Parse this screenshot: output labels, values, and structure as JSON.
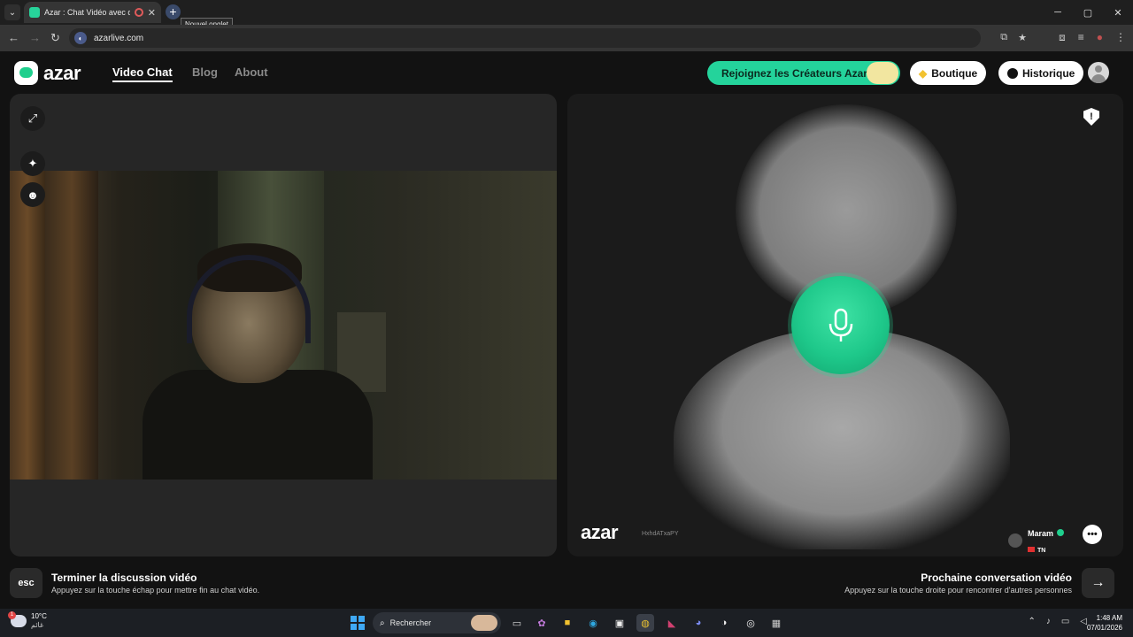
{
  "browser": {
    "tab_title": "Azar : Chat Vidéo avec de n",
    "tab_close": "✕",
    "new_tab": "+",
    "tooltip": "Nouvel onglet",
    "url": "azarlive.com",
    "window_controls": [
      "─",
      "▢",
      "✕"
    ]
  },
  "site": {
    "logo_text": "azar",
    "nav": [
      "Video Chat",
      "Blog",
      "About"
    ],
    "creators_label": "Rejoignez les Créateurs Azar",
    "shop_label": "Boutique",
    "history_label": "Historique"
  },
  "remote": {
    "logo_text": "azar",
    "id": "HxhdATxaPY",
    "peer_name": "Maram",
    "peer_country": "TN",
    "chat_icon": "•••"
  },
  "instructions": {
    "esc_key": "esc",
    "end_title": "Terminer la discussion vidéo",
    "end_desc": "Appuyez sur la touche échap pour mettre fin au chat vidéo.",
    "next_title": "Prochaine conversation vidéo",
    "next_desc": "Appuyez sur la touche droite pour rencontrer d'autres personnes",
    "next_arrow": "→"
  },
  "taskbar": {
    "weather_temp": "10°C",
    "weather_cond": "غائم",
    "weather_badge": "1",
    "search_placeholder": "Rechercher",
    "time": "1:48 AM",
    "date": "07/01/2026"
  },
  "colors": {
    "accent": "#24d39b",
    "background": "#121212"
  }
}
